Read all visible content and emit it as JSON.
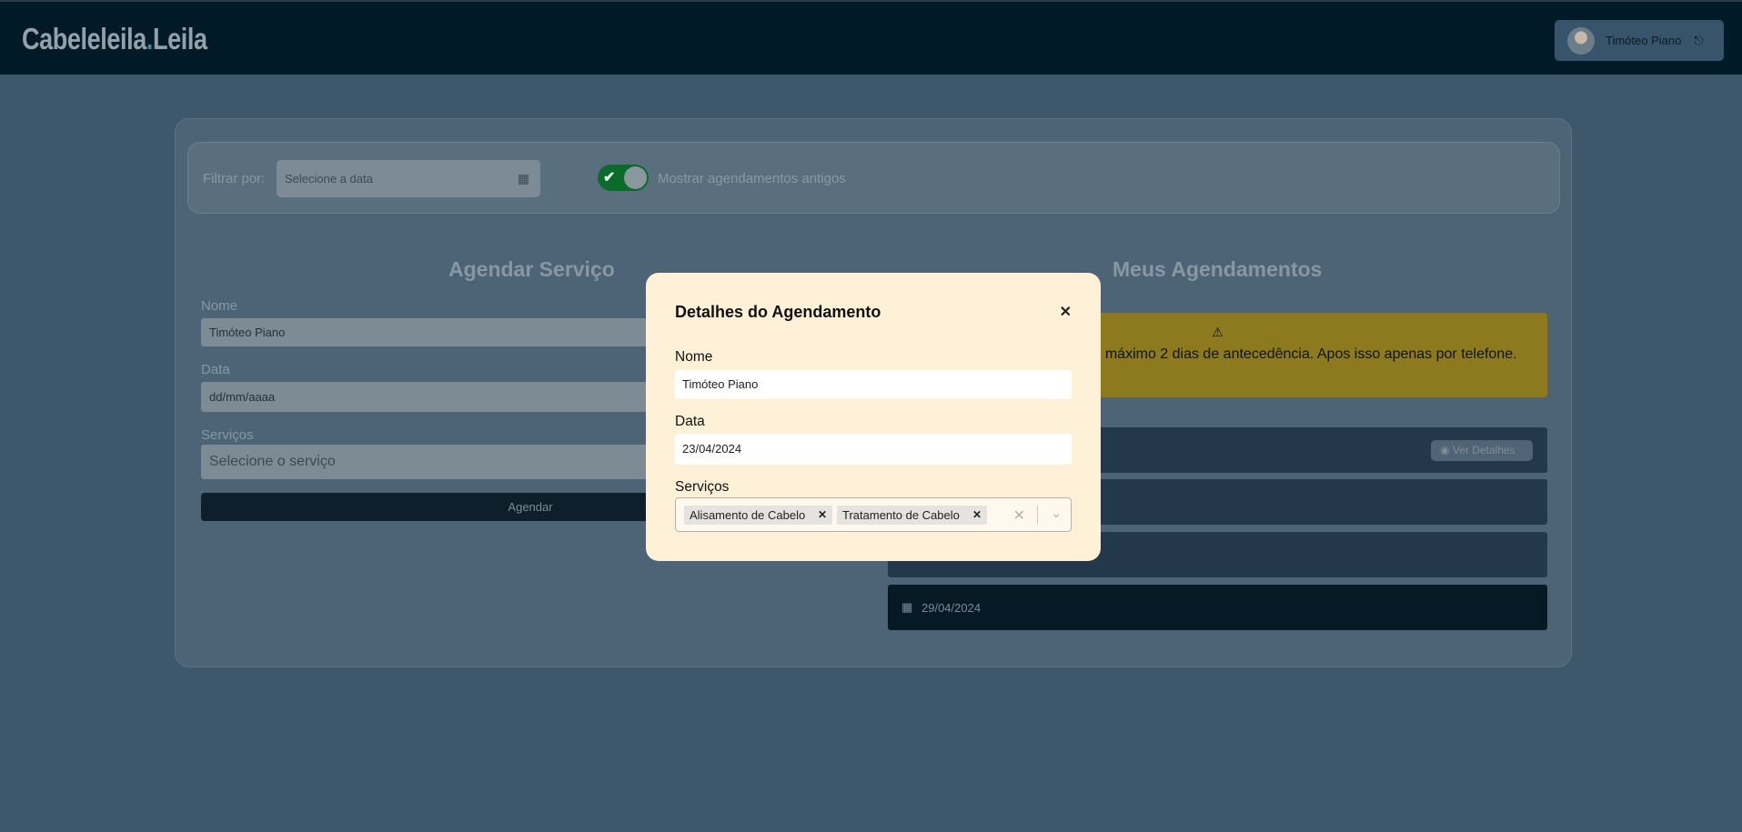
{
  "header": {
    "logo_part1": "Cabeleleila",
    "logo_dot": ".",
    "logo_part2": "Leila",
    "user_name": "Timóteo Piano"
  },
  "filter": {
    "label": "Filtrar por:",
    "date_placeholder": "Selecione a data",
    "toggle_label": "Mostrar agendamentos antigos",
    "toggle_on": true
  },
  "schedule_form": {
    "title": "Agendar Serviço",
    "name_label": "Nome",
    "name_value": "Timóteo Piano",
    "date_label": "Data",
    "date_value": "dd/mm/aaaa",
    "services_label": "Serviços",
    "services_placeholder": "Selecione o serviço",
    "submit_label": "Agendar"
  },
  "appointments": {
    "title": "Meus Agendamentos",
    "warning_icon": "⚠",
    "warning_text": "odem ser realizadas com no máximo 2 dias de antecedência. Apos isso apenas por telefone.",
    "details_label": "Ver Detalhes",
    "last_date": "29/04/2024"
  },
  "modal": {
    "title": "Detalhes do Agendamento",
    "name_label": "Nome",
    "name_value": "Timóteo Piano",
    "date_label": "Data",
    "date_value": "23/04/2024",
    "services_label": "Serviços",
    "services": [
      "Alisamento de Cabelo",
      "Tratamento de Cabelo"
    ]
  },
  "colors": {
    "header_bg": "#001a27",
    "page_bg": "#3e576b",
    "modal_bg": "#fff0d8",
    "toggle_on": "#0b6b2a",
    "warning_bg": "#8d7a1f"
  }
}
